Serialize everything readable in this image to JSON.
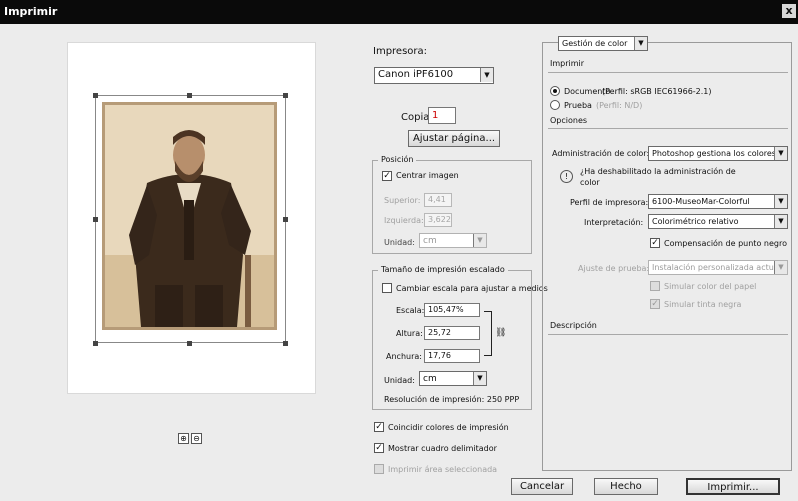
{
  "window": {
    "title": "Imprimir",
    "close_glyph": "x"
  },
  "left": {
    "zoom_icons": [
      "zoom-in-icon",
      "zoom-out-icon"
    ],
    "zoom_glyphs": [
      "⊕",
      "⊖"
    ]
  },
  "printer": {
    "label": "Impresora:",
    "value": "Canon iPF6100",
    "copies_label": "Copias:",
    "copies_value": "1",
    "setup_button": "Ajustar página..."
  },
  "position": {
    "legend": "Posición",
    "center_label": "Centrar imagen",
    "center_checked": true,
    "top_label": "Superior:",
    "top_value": "4,41",
    "left_label": "Izquierda:",
    "left_value": "3,622",
    "unit_label": "Unidad:",
    "unit_value": "cm"
  },
  "scaled": {
    "legend": "Tamaño de impresión escalado",
    "fit_label": "Cambiar escala para ajustar a medios",
    "fit_checked": false,
    "scale_label": "Escala:",
    "scale_value": "105,47%",
    "height_label": "Altura:",
    "height_value": "25,72",
    "width_label": "Anchura:",
    "width_value": "17,76",
    "unit_label": "Unidad:",
    "unit_value": "cm",
    "resolution": "Resolución de impresión: 250 PPP"
  },
  "options_bottom": {
    "match_colors": "Coincidir colores de impresión",
    "match_colors_checked": true,
    "bounding_box": "Mostrar cuadro delimitador",
    "bounding_box_checked": true,
    "print_selected": "Imprimir área seleccionada"
  },
  "color_mgmt": {
    "dropdown": "Gestión de color",
    "print_header": "Imprimir",
    "document_label": "Documento",
    "document_profile": "(Perfil: sRGB IEC61966-2.1)",
    "proof_label": "Prueba",
    "proof_profile": "(Perfil: N/D)",
    "options_header": "Opciones",
    "color_handling_label": "Administración de color:",
    "color_handling_value": "Photoshop gestiona los colores",
    "warning_text_line1": "¿Ha deshabilitado la administración de",
    "warning_text_line2": "color",
    "printer_profile_label": "Perfil de impresora:",
    "printer_profile_value": "6100-MuseoMar-Colorful",
    "intent_label": "Interpretación:",
    "intent_value": "Colorimétrico relativo",
    "bpc_label": "Compensación de punto negro",
    "bpc_checked": true,
    "proof_setup_label": "Ajuste de prueba:",
    "proof_setup_value": "Instalación personalizada actual",
    "sim_paper": "Simular color del papel",
    "sim_ink": "Simular tinta negra",
    "description_header": "Descripción"
  },
  "footer": {
    "cancel": "Cancelar",
    "done": "Hecho",
    "print": "Imprimir..."
  }
}
